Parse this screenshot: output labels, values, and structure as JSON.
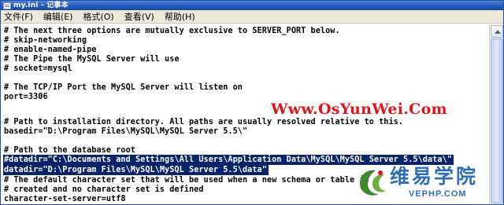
{
  "window": {
    "title": "my.ini - 记事本"
  },
  "menu": [
    "文件(F)",
    "编辑(E)",
    "格式(O)",
    "查看(V)",
    "帮助(H)"
  ],
  "editor": {
    "lines": [
      "# The next three options are mutually exclusive to SERVER_PORT below.",
      "# skip-networking",
      "# enable-named-pipe",
      "# The Pipe the MySQL Server will use",
      "# socket=mysql",
      "",
      "# The TCP/IP Port the MySQL Server will listen on",
      "port=3306",
      "",
      "",
      "# Path to installation directory. All paths are usually resolved relative to this.",
      "basedir=\"D:\\Program Files\\MySQL\\MySQL Server 5.5\\\"",
      "",
      "# Path to the database root",
      "#datadir=\"C:\\Documents and Settings\\All Users\\Application Data\\MySQL\\MySQL Server 5.5\\data\\\"",
      "datadir=\"D:\\Program Files\\MySQL\\MySQL Server 5.5\\data\"",
      "# The default character set that will be used when a new schema or table is",
      "# created and no character set is defined",
      "character-set-server=utf8"
    ]
  },
  "watermarks": {
    "osyunwei": "Www.OsYunWei.Com",
    "site_cn": "维易学院",
    "site_en": "VEPHP.COM"
  },
  "colors": {
    "selection": "#0a246a",
    "titlebar": "#2357b8",
    "watermark_red": "#e2151b",
    "watermark_blue": "#2f6fb4"
  }
}
